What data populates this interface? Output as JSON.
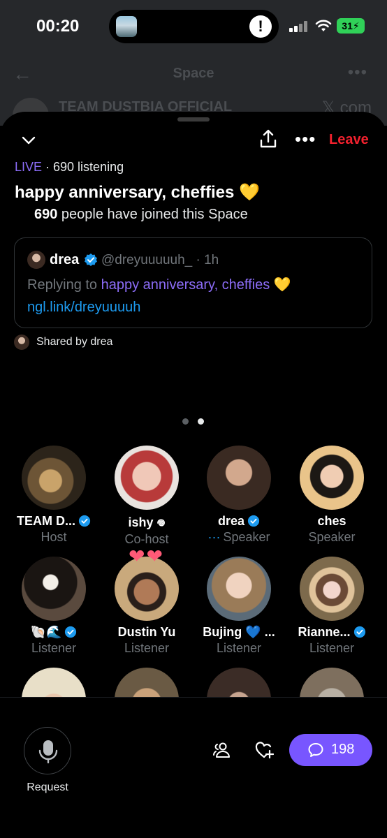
{
  "status_bar": {
    "time": "00:20",
    "battery": "31"
  },
  "background_page": {
    "title": "Space",
    "host_name": "TEAM DUSTBIA OFFICIAL",
    "right_text": "𝕏 com"
  },
  "sheet": {
    "leave_label": "Leave",
    "live_label": "LIVE",
    "listening_text": " · 690 listening",
    "space_title": "happy anniversary, cheffies 💛",
    "joined_count": "690",
    "joined_text": " people have joined this Space"
  },
  "post": {
    "author": "drea",
    "handle": "@dreyuuuuuh_ · 1h",
    "reply_prefix": "Replying to ",
    "reply_title": "happy anniversary, cheffies",
    "reply_emoji": " 💛",
    "link": "ngl.link/dreyuuuuh"
  },
  "shared_by": "Shared by drea",
  "participants": [
    {
      "name": "TEAM D...",
      "role": "Host",
      "verified": true
    },
    {
      "name": "ishy 𖦹",
      "role": "Co-host",
      "verified": false
    },
    {
      "name": "drea",
      "role": "Speaker",
      "verified": true,
      "speaking_dots": "···"
    },
    {
      "name": "ches",
      "role": "Speaker",
      "verified": false
    },
    {
      "name": "🐚🌊",
      "role": "Listener",
      "verified": true
    },
    {
      "name": "Dustin Yu",
      "role": "Listener",
      "verified": false
    },
    {
      "name": "Bujing 💙 ...",
      "role": "Listener",
      "verified": false
    },
    {
      "name": "Rianne...",
      "role": "Listener",
      "verified": true
    }
  ],
  "hearts": "❤❤",
  "bottom": {
    "request_label": "Request",
    "comment_count": "198"
  },
  "colors": {
    "accent": "#7856ff",
    "live": "#8b6cf6",
    "leave": "#f4212e",
    "link": "#1d9bf0",
    "verified": "#1d9bf0"
  }
}
